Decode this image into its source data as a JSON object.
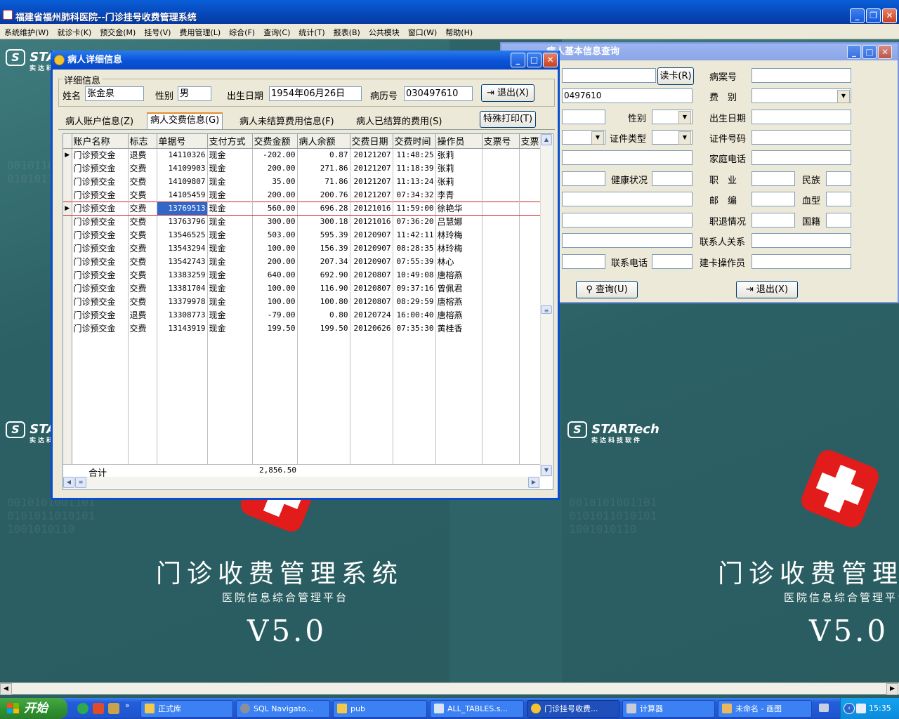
{
  "window": {
    "title": "福建省福州肺科医院--门诊挂号收费管理系统"
  },
  "menu": [
    "系统维护(W)",
    "就诊卡(K)",
    "预交金(M)",
    "挂号(V)",
    "费用管理(L)",
    "综合(F)",
    "查询(C)",
    "统计(T)",
    "报表(B)",
    "公共模块",
    "窗口(W)",
    "帮助(H)"
  ],
  "background": {
    "logo": "STARTech",
    "logo_sub": "实达科技软件",
    "title": "门诊收费管理系统",
    "subtitle": "医院信息综合管理平台",
    "version": "V5.0",
    "title_right": "门诊收费管理",
    "subtitle_right": "医院信息综合管理平台"
  },
  "query_window": {
    "title": "病人基本信息查询",
    "read_card": "读卡(R)",
    "card_no_value": "0497610",
    "labels": {
      "case_no": "病案号",
      "fee_type": "费　别",
      "gender": "性别",
      "birth_date": "出生日期",
      "id_type": "证件类型",
      "id_no": "证件号码",
      "home_phone": "家庭电话",
      "health": "健康状况",
      "occupation": "职　业",
      "ethnicity": "民族",
      "postcode": "邮　编",
      "blood_type": "血型",
      "retire": "职退情况",
      "nationality": "国籍",
      "contact_rel": "联系人关系",
      "contact_phone": "联系电话",
      "card_operator": "建卡操作员"
    },
    "query_button": "查询(U)",
    "exit_button": "退出(X)"
  },
  "detail_window": {
    "title": "病人详细信息",
    "group_title": "详细信息",
    "name_label": "姓名",
    "name_value": "张金泉",
    "gender_label": "性别",
    "gender_value": "男",
    "birth_label": "出生日期",
    "birth_value": "1954年06月26日",
    "record_label": "病历号",
    "record_value": "030497610",
    "exit_button": "退出(X)",
    "print_button": "特殊打印(T)",
    "tabs": [
      "病人账户信息(Z)",
      "病人交费信息(G)",
      "病人未结算费用信息(F)",
      "病人已结算的费用(S)"
    ],
    "active_tab": 1
  },
  "grid": {
    "columns": [
      "账户名称",
      "标志",
      "单据号",
      "支付方式",
      "交费金额",
      "病人余额",
      "交费日期",
      "交费时间",
      "操作员",
      "支票号",
      "支票"
    ],
    "rows": [
      [
        "门诊预交金",
        "退费",
        "14110326",
        "现金",
        "-202.00",
        "0.87",
        "20121207",
        "11:48:25",
        "张莉",
        "",
        ""
      ],
      [
        "门诊预交金",
        "交费",
        "14109903",
        "现金",
        "200.00",
        "271.86",
        "20121207",
        "11:18:39",
        "张莉",
        "",
        ""
      ],
      [
        "门诊预交金",
        "交费",
        "14109807",
        "现金",
        "35.00",
        "71.86",
        "20121207",
        "11:13:24",
        "张莉",
        "",
        ""
      ],
      [
        "门诊预交金",
        "交费",
        "14105459",
        "现金",
        "200.00",
        "200.76",
        "20121207",
        "07:34:32",
        "李青",
        "",
        ""
      ],
      [
        "门诊预交金",
        "交费",
        "13769513",
        "现金",
        "560.00",
        "696.28",
        "20121016",
        "11:59:00",
        "徐艳华",
        "",
        ""
      ],
      [
        "门诊预交金",
        "交费",
        "13763796",
        "现金",
        "300.00",
        "300.18",
        "20121016",
        "07:36:20",
        "吕慧娜",
        "",
        ""
      ],
      [
        "门诊预交金",
        "交费",
        "13546525",
        "现金",
        "503.00",
        "595.39",
        "20120907",
        "11:42:11",
        "林玲梅",
        "",
        ""
      ],
      [
        "门诊预交金",
        "交费",
        "13543294",
        "现金",
        "100.00",
        "156.39",
        "20120907",
        "08:28:35",
        "林玲梅",
        "",
        ""
      ],
      [
        "门诊预交金",
        "交费",
        "13542743",
        "现金",
        "200.00",
        "207.34",
        "20120907",
        "07:55:39",
        "林心",
        "",
        ""
      ],
      [
        "门诊预交金",
        "交费",
        "13383259",
        "现金",
        "640.00",
        "692.90",
        "20120807",
        "10:49:08",
        "唐榕燕",
        "",
        ""
      ],
      [
        "门诊预交金",
        "交费",
        "13381704",
        "现金",
        "100.00",
        "116.90",
        "20120807",
        "09:37:16",
        "曾佩君",
        "",
        ""
      ],
      [
        "门诊预交金",
        "交费",
        "13379978",
        "现金",
        "100.00",
        "100.80",
        "20120807",
        "08:29:59",
        "唐榕燕",
        "",
        ""
      ],
      [
        "门诊预交金",
        "退费",
        "13308773",
        "现金",
        "-79.00",
        "0.80",
        "20120724",
        "16:00:40",
        "唐榕燕",
        "",
        ""
      ],
      [
        "门诊预交金",
        "交费",
        "13143919",
        "现金",
        "199.50",
        "199.50",
        "20120626",
        "07:35:30",
        "黄桂香",
        "",
        ""
      ]
    ],
    "selected_row": 4,
    "total_label": "合计",
    "total_value": "2,856.50"
  },
  "taskbar": {
    "start": "开始",
    "items": [
      "正式库",
      "SQL Navigato...",
      "pub",
      "ALL_TABLES.s...",
      "门诊挂号收费...",
      "计算器",
      "未命名 - 画图"
    ],
    "active_item": 4,
    "clock": "15:35"
  },
  "colors": {
    "titlebar": "#0a55da",
    "desktop": "#2e6467",
    "selection": "#3168c8",
    "selected_row_border": "#d02020"
  }
}
